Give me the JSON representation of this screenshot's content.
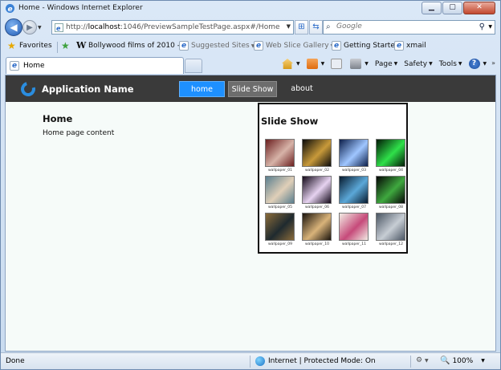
{
  "window": {
    "title": "Home - Windows Internet Explorer"
  },
  "address_bar": {
    "url_prefix": "http://",
    "url_host": "localhost",
    "url_rest": ":1046/PreviewSampleTestPage.aspx#/Home"
  },
  "search": {
    "placeholder": "Google"
  },
  "favorites_bar": {
    "favorites_label": "Favorites",
    "items": [
      {
        "label": "Bollywood films of 2010 - ..."
      },
      {
        "label": "Suggested Sites"
      },
      {
        "label": "Web Slice Gallery"
      },
      {
        "label": "Getting Started"
      },
      {
        "label": "xmail"
      }
    ]
  },
  "tabs": {
    "active_label": "Home"
  },
  "command_bar": {
    "page_label": "Page",
    "safety_label": "Safety",
    "tools_label": "Tools"
  },
  "app": {
    "name": "Application Name",
    "menu": [
      {
        "label": "home"
      },
      {
        "label": "Slide Show"
      },
      {
        "label": "about"
      }
    ],
    "home_title": "Home",
    "home_content": "Home page content",
    "slideshow": {
      "title": "Slide Show",
      "thumbnails": [
        {
          "caption": "wallpaper_01",
          "colors": [
            "#6b1f1f",
            "#d7b3a8"
          ]
        },
        {
          "caption": "wallpaper_02",
          "colors": [
            "#0a0a0a",
            "#c89a3a"
          ]
        },
        {
          "caption": "wallpaper_03",
          "colors": [
            "#0c1e4a",
            "#9fc6ff"
          ]
        },
        {
          "caption": "wallpaper_04",
          "colors": [
            "#021a06",
            "#2fe04a"
          ]
        },
        {
          "caption": "wallpaper_05",
          "colors": [
            "#5a7f8f",
            "#e0cfb8"
          ]
        },
        {
          "caption": "wallpaper_06",
          "colors": [
            "#120818",
            "#e6d2f0"
          ]
        },
        {
          "caption": "wallpaper_07",
          "colors": [
            "#071a2e",
            "#5ba8d8"
          ]
        },
        {
          "caption": "wallpaper_08",
          "colors": [
            "#050505",
            "#3fa83f"
          ]
        },
        {
          "caption": "wallpaper_09",
          "colors": [
            "#8a6b3a",
            "#1f2a2f"
          ]
        },
        {
          "caption": "wallpaper_10",
          "colors": [
            "#1a130c",
            "#d9b37a"
          ]
        },
        {
          "caption": "wallpaper_11",
          "colors": [
            "#f2ece4",
            "#c64a7a"
          ]
        },
        {
          "caption": "wallpaper_12",
          "colors": [
            "#4a5563",
            "#c7cdd4"
          ]
        }
      ]
    }
  },
  "status_bar": {
    "left_text": "Done",
    "zone_text": "Internet | Protected Mode: On",
    "zoom": "100%"
  },
  "colors": {
    "app_header": "#3a3a3a",
    "menu_selected": "#1e90ff",
    "page_bg": "#f6fbf9"
  }
}
